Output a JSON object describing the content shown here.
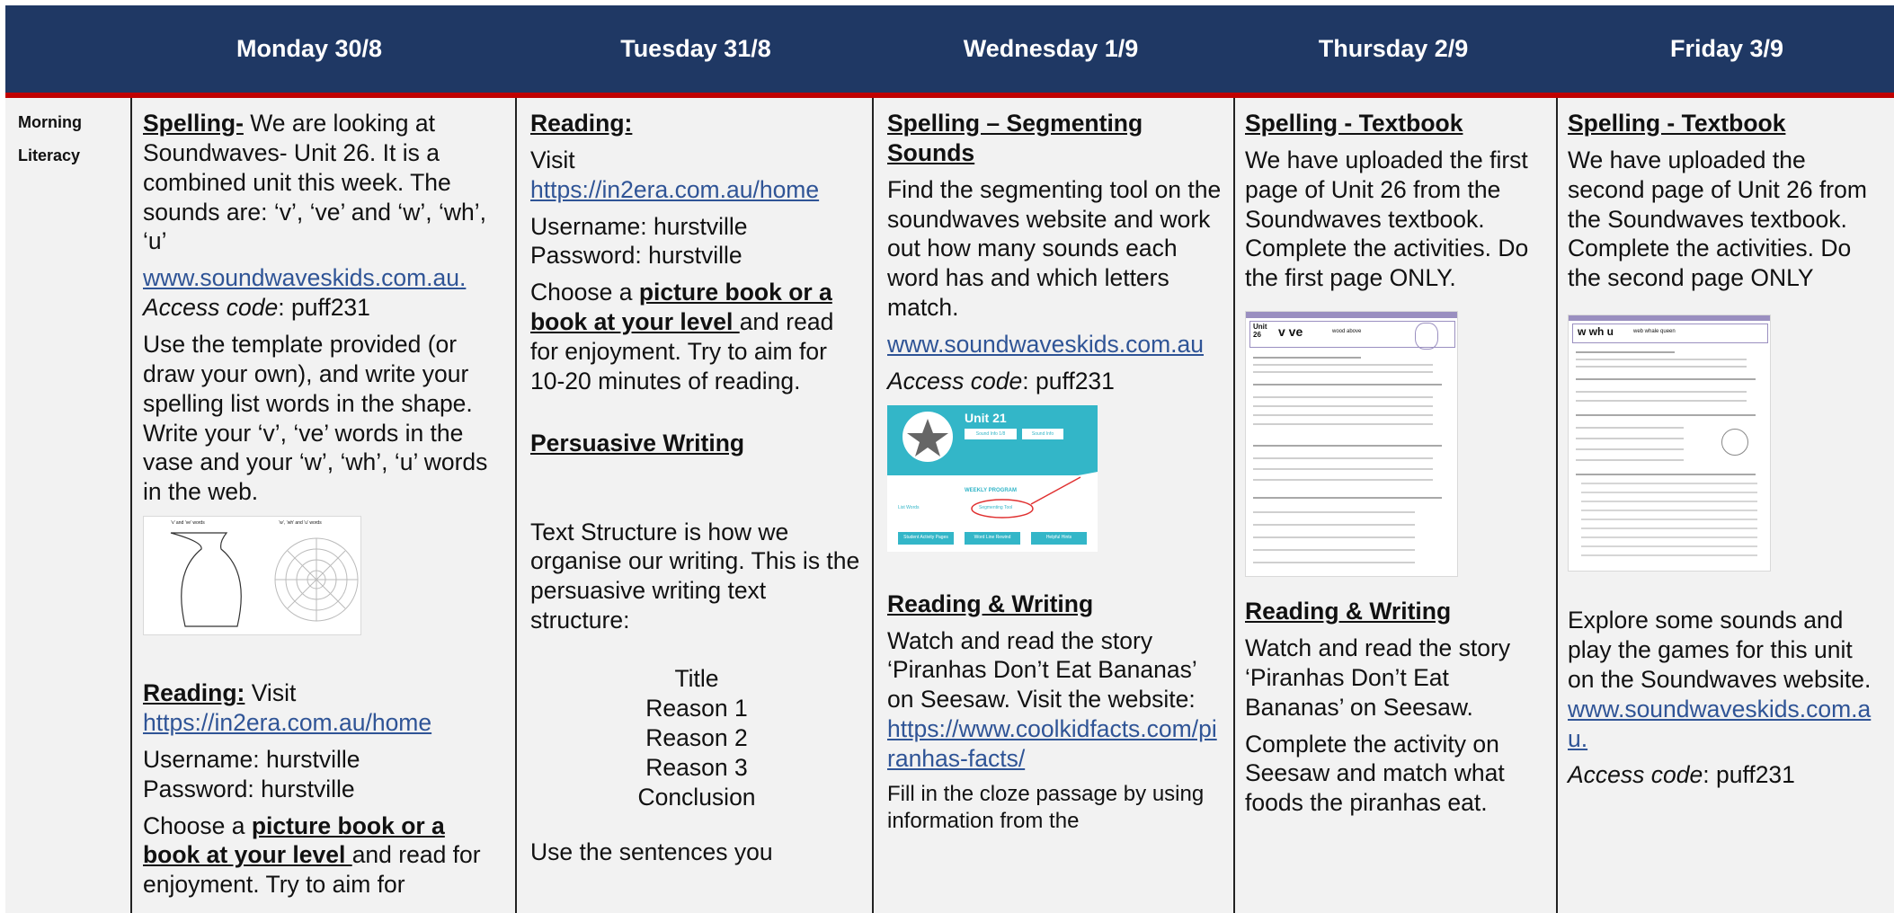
{
  "header": {
    "days": [
      "Monday 30/8",
      "Tuesday 31/8",
      "Wednesday 1/9",
      "Thursday 2/9",
      "Friday 3/9"
    ]
  },
  "row": {
    "label_line1": "Morning",
    "label_line2": "Literacy"
  },
  "colors": {
    "header_bg": "#1f3864",
    "header_rule": "#c00000",
    "link": "#2f5496",
    "cell_bg": "#f2f2f2"
  },
  "monday": {
    "spelling_heading": "Spelling-",
    "spelling_text": " We are looking at Soundwaves- Unit 26. It is a combined unit this week. The sounds are: ‘v’, ‘ve’ and ‘w’, ‘wh’, ‘u’",
    "link": "www.soundwaveskids.com.au.",
    "access_label": "Access code",
    "access_value": ": puff231",
    "template_text": "Use the template provided (or draw your own), and write your spelling list words in the shape. Write your ‘v’, ‘ve’ words in the vase and your ‘w’, ‘wh’, ‘u’ words in the web.",
    "image_caption_left": "‘v’ and ‘ve’ words",
    "image_caption_right": "‘w’, ‘wh’ and ‘u’ words",
    "reading_heading": "Reading:",
    "reading_visit": " Visit",
    "reading_link": "https://in2era.com.au/home",
    "username": "Username: hurstville",
    "password": "Password: hurstville",
    "choose_pre": "Choose a ",
    "choose_bold": "picture book or a book at your level ",
    "choose_post": "and read for enjoyment. Try to aim for"
  },
  "tuesday": {
    "reading_heading": "Reading:",
    "visit": "Visit",
    "link": "https://in2era.com.au/home",
    "username": "Username: hurstville",
    "password": "Password: hurstville",
    "choose_pre": "Choose a ",
    "choose_bold": "picture book or a book at your level ",
    "choose_post": "and read for enjoyment. Try to aim for 10-20 minutes of reading.",
    "persuasive_heading": "Persuasive Writing",
    "structure_text": "Text Structure is how we organise our writing. This is the persuasive writing text structure:",
    "structure_items": [
      "Title",
      "Reason 1",
      "Reason 2",
      "Reason 3",
      "Conclusion"
    ],
    "sentences_text": "Use the sentences you"
  },
  "wednesday": {
    "spelling_heading": "Spelling – Segmenting Sounds",
    "spelling_text": "Find the segmenting tool on the soundwaves website and work out how many sounds each word has and which letters match.",
    "link": "www.soundwaveskids.com.au",
    "access_label": "Access code",
    "access_value": ": puff231",
    "screenshot": {
      "unit": "Unit 21",
      "btn1": "Sound Info 1/8",
      "btn2": "Sound Info",
      "program": "WEEKLY PROGRAM",
      "item1": "List Words",
      "item2": "Segmenting Tool",
      "foot1": "Student Activity Pages",
      "foot2": "Word Line Rewind",
      "foot3": "Helpful Hints"
    },
    "rw_heading": "Reading & Writing",
    "rw_text": "Watch and read the story ‘Piranhas Don’t Eat Bananas’ on Seesaw. Visit the website:",
    "rw_link": "https://www.coolkidfacts.com/piranhas-facts/",
    "cloze_text": "Fill in the cloze passage by using information from the"
  },
  "thursday": {
    "spelling_heading": "Spelling - Textbook",
    "spelling_text": "We have uploaded the first page of Unit 26 from the Soundwaves textbook. Complete the activities. Do the first page ONLY.",
    "worksheet_unit": "Unit 26",
    "worksheet_title": "v ve",
    "worksheet_words": "wood  above",
    "rw_heading": "Reading & Writing",
    "rw_text": "Watch and read the story ‘Piranhas Don’t Eat Bananas’ on Seesaw.",
    "activity_text": "Complete the activity on Seesaw and match what foods the piranhas eat."
  },
  "friday": {
    "spelling_heading": "Spelling - Textbook",
    "spelling_text": "We have uploaded the second page of Unit 26 from the Soundwaves textbook. Complete the activities. Do the second page ONLY",
    "worksheet_title": "w wh u",
    "worksheet_words": "web  whale  queen",
    "explore_text": "Explore some sounds and play the games for this unit on the Soundwaves website.",
    "link": "www.soundwaveskids.com.au.",
    "access_label": "Access code",
    "access_value": ": puff231"
  }
}
